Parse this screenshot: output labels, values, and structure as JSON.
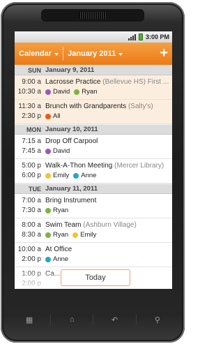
{
  "status": {
    "time": "3:00 PM"
  },
  "actionbar": {
    "calendar_label": "Calendar",
    "month_label": "January 2011",
    "add_label": "+"
  },
  "days": [
    {
      "dow": "SUN",
      "date": "January 9, 2011",
      "events": [
        {
          "start": "9:00 a",
          "end": "10:30 a",
          "title": "Lacrosse Practice",
          "location": "(Bellevue HS)",
          "trailing": "First ...",
          "highlight": true,
          "people": [
            {
              "name": "David",
              "color": "#9b59b6"
            },
            {
              "name": "Ryan",
              "color": "#7cb342"
            }
          ]
        },
        {
          "start": "11:30 a",
          "end": "2:30 p",
          "title": "Brunch with Grandparents",
          "location": "(Salty's)",
          "trailing": "",
          "highlight": true,
          "people": [
            {
              "name": "All",
              "color": "#e65c1a"
            }
          ]
        }
      ]
    },
    {
      "dow": "MON",
      "date": "January 10, 2011",
      "events": [
        {
          "start": "7:15 a",
          "end": "7:45 a",
          "title": "Drop Off Carpool",
          "location": "",
          "trailing": "",
          "highlight": false,
          "people": [
            {
              "name": "David",
              "color": "#9b59b6"
            }
          ]
        },
        {
          "start": "5:00 p",
          "end": "6:00 p",
          "title": "Walk-A-Thon Meeting",
          "location": "(Mercer Library)",
          "trailing": "",
          "highlight": false,
          "people": [
            {
              "name": "Emily",
              "color": "#f4c430"
            },
            {
              "name": "Anne",
              "color": "#26a6c8"
            }
          ]
        }
      ]
    },
    {
      "dow": "TUE",
      "date": "January 11, 2011",
      "events": [
        {
          "start": "7:00 a",
          "end": "7:30 a",
          "title": "Bring Instrument",
          "location": "",
          "trailing": "",
          "highlight": false,
          "people": [
            {
              "name": "Ryan",
              "color": "#7cb342"
            }
          ]
        },
        {
          "start": "8:00 a",
          "end": "8:30 a",
          "title": "Swim Team",
          "location": "(Ashburn Village)",
          "trailing": "",
          "highlight": false,
          "people": [
            {
              "name": "Ryan",
              "color": "#7cb342"
            },
            {
              "name": "Emily",
              "color": "#f4c430"
            }
          ]
        },
        {
          "start": "10:00 a",
          "end": "2:00 p",
          "title": "At Office",
          "location": "",
          "trailing": "",
          "highlight": false,
          "people": [
            {
              "name": "Anne",
              "color": "#26a6c8"
            }
          ]
        },
        {
          "start": "1:00 p",
          "end": "2:00 p",
          "title": "Ca...",
          "location": "",
          "trailing": "",
          "highlight": false,
          "people": []
        }
      ]
    }
  ],
  "today_label": "Today",
  "hardware": {
    "menu": "▦",
    "home": "⌂",
    "back": "↶",
    "search": "⚲"
  }
}
